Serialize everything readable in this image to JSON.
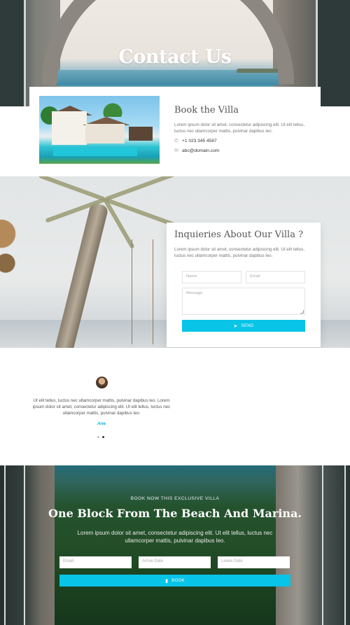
{
  "hero": {
    "title": "Contact Us"
  },
  "book_villa": {
    "title": "Book the Villa",
    "text": "Lorem ipsum dolor sit amet, consectetur adipiscing elit. Ut elit tellus, luctus nec ullamcorper mattis, pulvinar dapibus leo.",
    "phone": "+1 023 345 4567",
    "email": "abc@domain.com",
    "phone_icon": "phone-icon",
    "mail_icon": "mail-icon"
  },
  "inquiry": {
    "title": "Inquieries About Our Villa ?",
    "text": "Lorem ipsum dolor sit amet, consectetur adipiscing elit. Ut elit tellus, luctus nec ullamcorper mattis, pulvinar dapibus leo.",
    "name_placeholder": "Name",
    "email_placeholder": "Email",
    "message_placeholder": "Message",
    "send_label": "SEND",
    "send_icon": "paper-plane-icon"
  },
  "testimonial": {
    "text": "Ut elit tellus, luctus nec ullamcorper mattis, pulvinar dapibus leo. Lorem ipsum dolor sit amet, consectetur adipiscing elit. Ut elit tellus, luctus nec ullamcorper mattis, pulvinar dapibus leo.",
    "name": "Ane",
    "slides": 2,
    "active_slide": 2
  },
  "booking": {
    "kicker": "BOOK NOW THIS EXCLUSIVE VILLA",
    "title": "One Block From The Beach And Marina.",
    "text": "Lorem ipsum dolor sit amet, consectetur adipiscing elit. Ut elit tellus, luctus nec ullamcorper mattis, pulvinar dapibus leo.",
    "email_placeholder": "Email",
    "arrive_placeholder": "Arrive Date",
    "leave_placeholder": "Leave Date",
    "book_label": "BOOK",
    "book_icon": "bookmark-icon"
  },
  "colors": {
    "accent": "#08c4e6",
    "heading": "#555555",
    "text": "#777777"
  }
}
